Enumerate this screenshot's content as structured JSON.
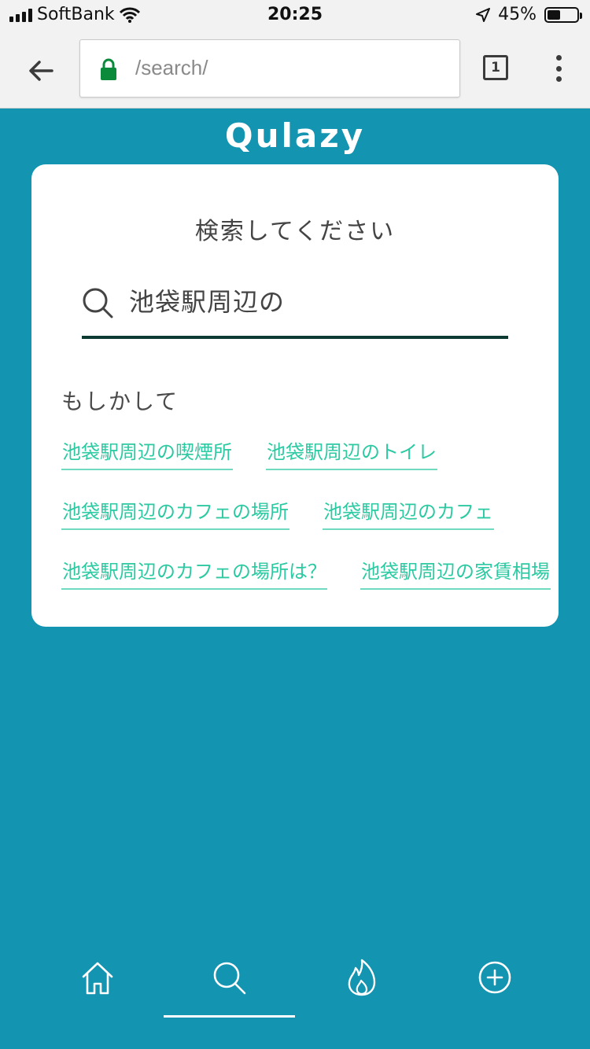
{
  "status_bar": {
    "carrier": "SoftBank",
    "time": "20:25",
    "battery": "45%",
    "battery_level": 0.45
  },
  "browser": {
    "url": "/search/",
    "tab_count": "1"
  },
  "brand": "Qulazy",
  "search": {
    "title": "検索してください",
    "query": "池袋駅周辺の"
  },
  "suggestions": {
    "heading": "もしかして",
    "items": [
      "池袋駅周辺の喫煙所",
      "池袋駅周辺のトイレ",
      "池袋駅周辺のカフェの場所",
      "池袋駅周辺のカフェ",
      "池袋駅周辺のカフェの場所は？",
      "池袋駅周辺の家賃相場"
    ]
  },
  "bottom_nav": {
    "items": [
      "home-icon",
      "search-icon",
      "fire-icon",
      "plus-circle-icon"
    ],
    "active": "search-icon"
  },
  "colors": {
    "background": "#1394b1",
    "accent": "#2cc9a2",
    "underline": "#0d3a32"
  }
}
